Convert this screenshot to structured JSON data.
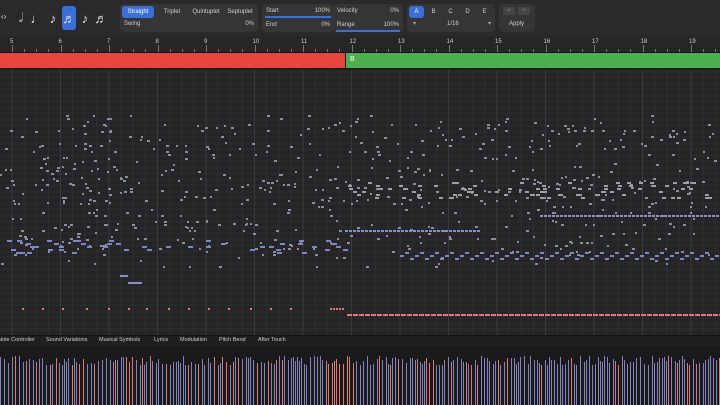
{
  "toolbar": {
    "note_values": [
      "half-note-icon",
      "quarter-note-icon",
      "eighth-note-icon",
      "sixteenth-note-icon",
      "thirtysecond-note-icon",
      "sixtyfourth-note-icon"
    ],
    "selected_note": 3,
    "feel": [
      "Straight",
      "Triplet",
      "Quintuplet",
      "Septuplet"
    ],
    "selected_feel": 0,
    "swing_label": "Swing",
    "swing_value": "0%",
    "start_label": "Start",
    "start_value": "100%",
    "end_label": "End",
    "end_value": "0%",
    "velocity_label": "Velocity",
    "velocity_value": "0%",
    "range_label": "Range",
    "range_value": "100%",
    "presets": [
      "A",
      "B",
      "C",
      "D",
      "E"
    ],
    "selected_preset": 0,
    "division": "1/16",
    "apply_label": "Apply"
  },
  "ruler": {
    "bars": [
      "5",
      "6",
      "7",
      "8",
      "9",
      "10",
      "11",
      "12",
      "13",
      "14",
      "15",
      "16",
      "17",
      "18",
      "19"
    ]
  },
  "regions": [
    {
      "label": "",
      "color": "#e8453c"
    },
    {
      "label": "B",
      "color": "#4caf50"
    }
  ],
  "lanes": [
    "Note Controller",
    "Sound Variations",
    "Musical Symbols",
    "Lyrics",
    "Modulation",
    "Pitch Bend",
    "After Touch"
  ],
  "colors": {
    "accent": "#3b6fd6",
    "note_blue": "#8a8fc8",
    "note_red": "#e07a78"
  }
}
